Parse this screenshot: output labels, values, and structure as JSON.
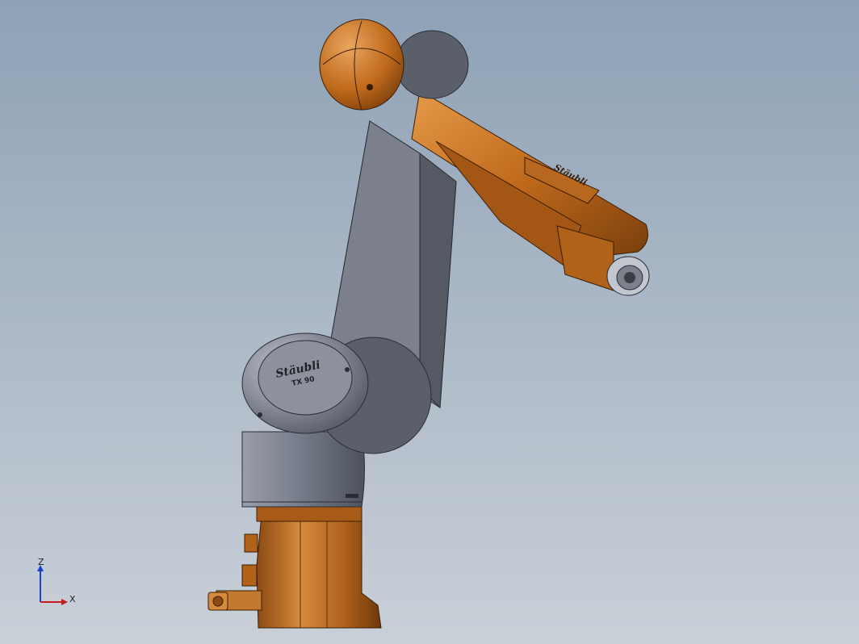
{
  "viewport": {
    "background_top": "#8ea1b6",
    "background_bottom": "#c9d0d8"
  },
  "model": {
    "arm_color": "#c26e1f",
    "body_color": "#7b808c",
    "dark_color": "#575c66",
    "brand_text": "Stäubli",
    "model_text": "TX 90",
    "arm_brand_text": "Stäubli"
  },
  "triad": {
    "z_label": "Z",
    "x_label": "X",
    "z_color": "#1d3fd0",
    "x_color": "#c41b1b"
  }
}
